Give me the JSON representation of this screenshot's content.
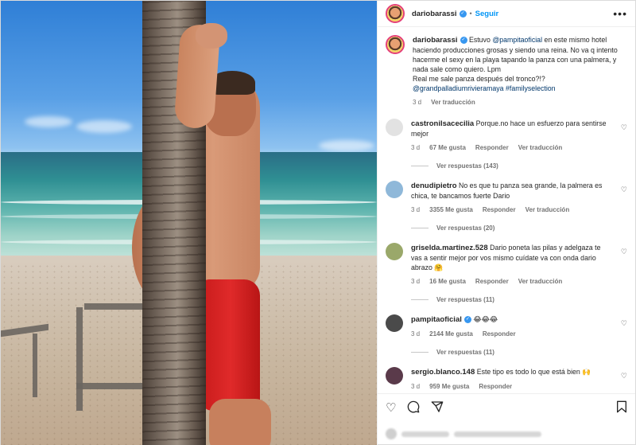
{
  "post": {
    "author": "dariobarassi",
    "follow_label": "Seguir",
    "more_label": "•••",
    "caption": {
      "author": "dariobarassi",
      "text_before_mention": "Estuvo",
      "mention": "@pampitaoficial",
      "text_after_mention": "en este mismo hotel haciendo producciones grosas y siendo una reina. No va q intento hacerme el sexy en la playa tapando la panza con una palmera, y nada sale como quiero. Lpm",
      "line2": "Real me sale panza después del tronco?!?",
      "tags": "@grandpalladiumrivieramaya #familyselection",
      "time": "3 d",
      "translate": "Ver traducción"
    }
  },
  "comments": [
    {
      "user": "castronilsacecilia",
      "text": "Porque.no hace un esfuerzo para sentirse mejor",
      "time": "3 d",
      "likes": "67 Me gusta",
      "reply": "Responder",
      "translate": "Ver traducción",
      "replies": "Ver respuestas (143)",
      "avatar_color": "#e2e2e2",
      "verified": false
    },
    {
      "user": "denudipietro",
      "text": "No es que tu panza sea grande, la palmera es chica, te bancamos fuerte Dario",
      "time": "3 d",
      "likes": "3355 Me gusta",
      "reply": "Responder",
      "translate": "Ver traducción",
      "replies": "Ver respuestas (20)",
      "avatar_color": "#8fb8d9",
      "verified": false
    },
    {
      "user": "griselda.martinez.528",
      "text": "Dario poneta las pilas y adelgaza te vas a sentir mejor por vos mismo cuídate va con onda dario abrazo 🤗",
      "time": "3 d",
      "likes": "16 Me gusta",
      "reply": "Responder",
      "translate": "Ver traducción",
      "replies": "Ver respuestas (11)",
      "avatar_color": "#9aa86a",
      "verified": false
    },
    {
      "user": "pampitaoficial",
      "text": "😂😂😂",
      "time": "3 d",
      "likes": "2144 Me gusta",
      "reply": "Responder",
      "translate": "",
      "replies": "Ver respuestas (11)",
      "avatar_color": "#4a4a4a",
      "verified": true
    },
    {
      "user": "sergio.blanco.148",
      "text": "Este tipo es todo lo que está bien 🙌",
      "time": "3 d",
      "likes": "959 Me gusta",
      "reply": "Responder",
      "translate": "",
      "replies": "",
      "avatar_color": "#5a3a4a",
      "verified": false
    }
  ],
  "icons": {
    "like": "heart-icon",
    "comment": "comment-icon",
    "share": "share-icon",
    "save": "bookmark-icon"
  },
  "colors": {
    "link": "#00376b",
    "follow": "#0095f6",
    "verified": "#3797f0"
  }
}
